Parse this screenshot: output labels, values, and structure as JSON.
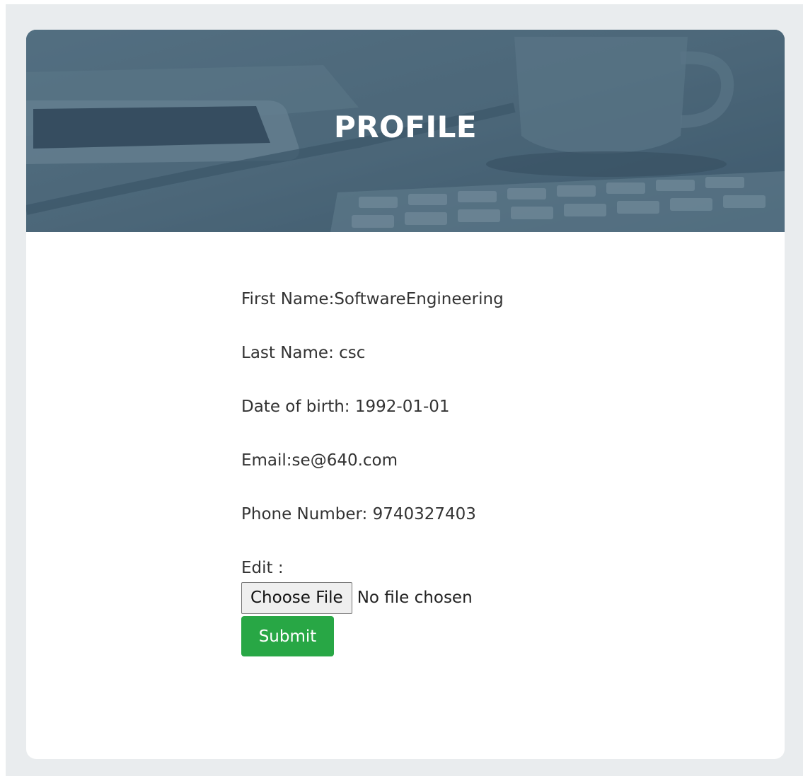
{
  "banner": {
    "title": "PROFILE"
  },
  "profile": {
    "first_name": "First Name:SoftwareEngineering",
    "last_name": "Last Name: csc",
    "dob": "Date of birth: 1992-01-01",
    "email": "Email:se@640.com",
    "phone": "Phone Number: 9740327403"
  },
  "edit": {
    "label": "Edit :",
    "choose_file_label": "Choose File",
    "file_status": "No file chosen",
    "submit_label": "Submit"
  },
  "colors": {
    "page_background": "#e9ecee",
    "banner_overlay": "#4d6b7e",
    "submit_green": "#28a745"
  }
}
